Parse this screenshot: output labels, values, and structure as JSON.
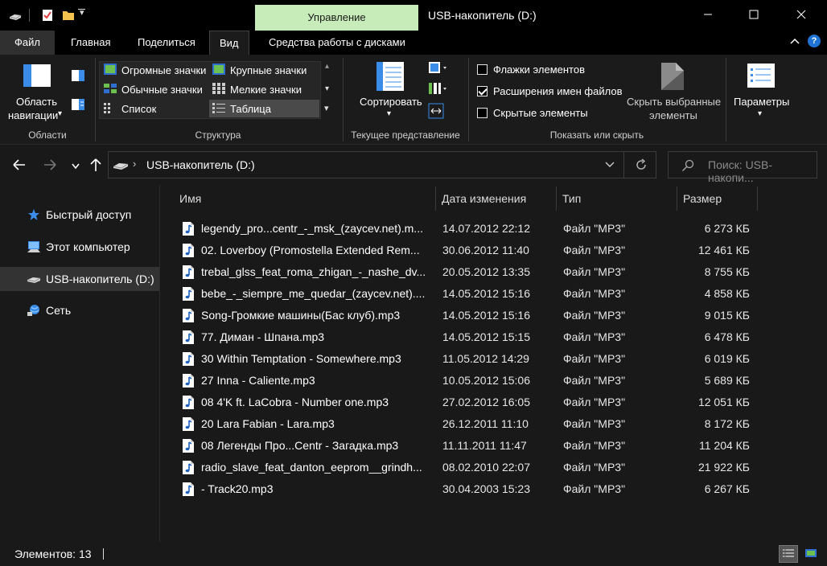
{
  "window": {
    "title": "USB-накопитель (D:)",
    "context_tab": "Управление",
    "minimize_icon": "minimize-icon",
    "maximize_icon": "maximize-icon",
    "close_icon": "close-icon"
  },
  "ribbon_tabs": [
    "Файл",
    "Главная",
    "Поделиться",
    "Вид",
    "Средства работы с дисками"
  ],
  "ribbon": {
    "areas": {
      "nav_pane_line1": "Область",
      "nav_pane_line2": "навигации",
      "group": "Области"
    },
    "layout": {
      "items": [
        "Огромные значки",
        "Крупные значки",
        "Обычные значки",
        "Мелкие значки",
        "Список",
        "Таблица"
      ],
      "selected": "Таблица",
      "group": "Структура"
    },
    "current_view": {
      "sort": "Сортировать",
      "group": "Текущее представление"
    },
    "show_hide": {
      "item_checkboxes": "Флажки элементов",
      "file_extensions": "Расширения имен файлов",
      "hidden_items": "Скрытые элементы",
      "hide_selected_line1": "Скрыть выбранные",
      "hide_selected_line2": "элементы",
      "group": "Показать или скрыть",
      "checked": {
        "item_checkboxes": false,
        "file_extensions": true,
        "hidden_items": false
      }
    },
    "options": {
      "label": "Параметры"
    }
  },
  "address": {
    "path": "USB-накопитель (D:)",
    "search_placeholder": "Поиск: USB-накопи..."
  },
  "nav_pane": [
    {
      "label": "Быстрый доступ",
      "icon": "star-icon"
    },
    {
      "label": "Этот компьютер",
      "icon": "computer-icon"
    },
    {
      "label": "USB-накопитель (D:)",
      "icon": "usb-drive-icon"
    },
    {
      "label": "Сеть",
      "icon": "network-icon"
    }
  ],
  "columns": [
    "Имя",
    "Дата изменения",
    "Тип",
    "Размер"
  ],
  "files": [
    {
      "name": "legendy_pro...centr_-_msk_(zaycev.net).m...",
      "date": "14.07.2012 22:12",
      "type": "Файл \"MP3\"",
      "size": "6 273 КБ"
    },
    {
      "name": "02. Loverboy (Promostella Extended Rem...",
      "date": "30.06.2012 11:40",
      "type": "Файл \"MP3\"",
      "size": "12 461 КБ"
    },
    {
      "name": "trebal_glss_feat_roma_zhigan_-_nashe_dv...",
      "date": "20.05.2012 13:35",
      "type": "Файл \"MP3\"",
      "size": "8 755 КБ"
    },
    {
      "name": "bebe_-_siempre_me_quedar_(zaycev.net)....",
      "date": "14.05.2012 15:16",
      "type": "Файл \"MP3\"",
      "size": "4 858 КБ"
    },
    {
      "name": "Song-Громкие машины(Бас клуб).mp3",
      "date": "14.05.2012 15:16",
      "type": "Файл \"MP3\"",
      "size": "9 015 КБ"
    },
    {
      "name": "77. Диман - Шпана.mp3",
      "date": "14.05.2012 15:15",
      "type": "Файл \"MP3\"",
      "size": "6 478 КБ"
    },
    {
      "name": "30 Within Temptation - Somewhere.mp3",
      "date": "11.05.2012 14:29",
      "type": "Файл \"MP3\"",
      "size": "6 019 КБ"
    },
    {
      "name": "27 Inna - Caliente.mp3",
      "date": "10.05.2012 15:06",
      "type": "Файл \"MP3\"",
      "size": "5 689 КБ"
    },
    {
      "name": "08 4'K ft. LaCobra - Number one.mp3",
      "date": "27.02.2012 16:05",
      "type": "Файл \"MP3\"",
      "size": "12 051 КБ"
    },
    {
      "name": "20 Lara Fabian - Lara.mp3",
      "date": "26.12.2011 11:10",
      "type": "Файл \"MP3\"",
      "size": "8 172 КБ"
    },
    {
      "name": "08 Легенды Про...Centr - Загадка.mp3",
      "date": "11.11.2011 11:47",
      "type": "Файл \"MP3\"",
      "size": "11 204 КБ"
    },
    {
      "name": "radio_slave_feat_danton_eeprom__grindh...",
      "date": "08.02.2010 22:07",
      "type": "Файл \"MP3\"",
      "size": "21 922 КБ"
    },
    {
      "name": "- Track20.mp3",
      "date": "30.04.2003 15:23",
      "type": "Файл \"MP3\"",
      "size": "6 267 КБ"
    }
  ],
  "status": {
    "count": "Элементов: 13"
  },
  "colors": {
    "context_tab": "#c7ecb9",
    "background": "#191919",
    "selected": "#333333",
    "accent": "#3b8be8"
  }
}
